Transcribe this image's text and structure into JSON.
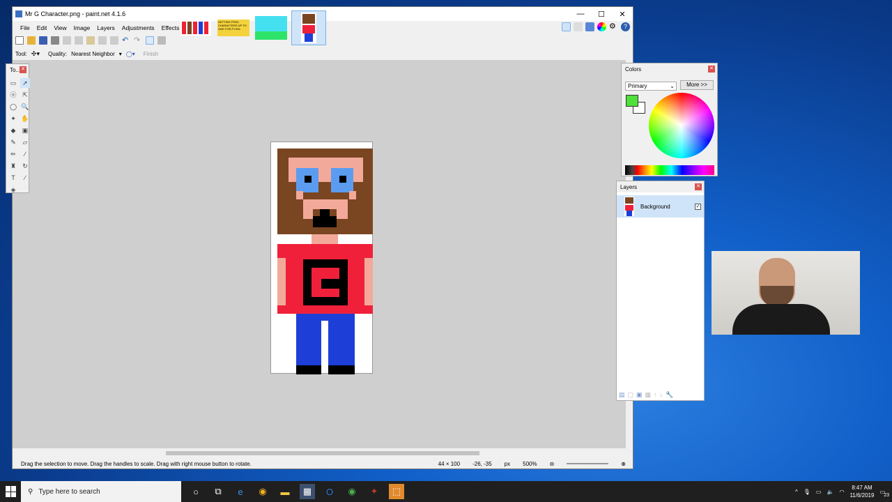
{
  "window": {
    "title": "Mr G Character.png - paint.net 4.1.6",
    "controls": {
      "minimize": "—",
      "maximize": "☐",
      "close": "✕"
    }
  },
  "menu": [
    "File",
    "Edit",
    "View",
    "Image",
    "Layers",
    "Adjustments",
    "Effects"
  ],
  "toolbar2": {
    "tool_label": "Tool:",
    "quality_label": "Quality:",
    "quality_value": "Nearest Neighbor",
    "finish_label": "Finish"
  },
  "thumbnail_text": "GETTING PIXEL CHARACTERS UP TO SIZE FOR PYXEL",
  "status": {
    "hint": "Drag the selection to move. Drag the handles to scale. Drag with right mouse button to rotate.",
    "size": "44 × 100",
    "coords": "-26, -35",
    "units": "px",
    "zoom": "500%"
  },
  "tools_panel": {
    "title": "To..."
  },
  "colors_panel": {
    "title": "Colors",
    "mode": "Primary",
    "more_button": "More >>",
    "primary_color": "#4fe03a",
    "secondary_color": "#ffffff"
  },
  "layers_panel": {
    "title": "Layers",
    "layers": [
      {
        "name": "Background",
        "visible": true
      }
    ]
  },
  "taskbar": {
    "search_placeholder": "Type here to search",
    "time": "8:47 AM",
    "date": "11/6/2019",
    "notification_count": "23"
  },
  "character_colors": {
    "hair": "#7a4521",
    "skin": "#f2a99a",
    "glasses": "#5b9cf0",
    "shirt": "#f0203a",
    "pants": "#1d3fd8",
    "black": "#000000",
    "white": "#ffffff"
  }
}
